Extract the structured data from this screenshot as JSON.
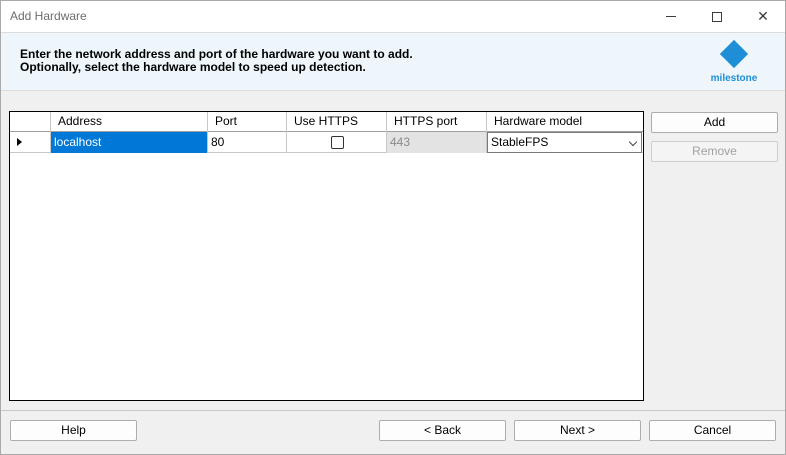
{
  "window": {
    "title": "Add Hardware",
    "controls": {
      "minimize": "",
      "maximize": "",
      "close": "✕"
    }
  },
  "header": {
    "line1": "Enter the network address and port of the hardware you want to add.",
    "line2": "Optionally, select the hardware model to speed up detection.",
    "logo_text": "milestone"
  },
  "grid": {
    "columns": [
      "Address",
      "Port",
      "Use HTTPS",
      "HTTPS port",
      "Hardware model"
    ],
    "rows": [
      {
        "address": "localhost",
        "port": "80",
        "use_https": false,
        "https_port": "443",
        "hardware_model": "StableFPS"
      }
    ]
  },
  "side_buttons": {
    "add": "Add",
    "remove": "Remove"
  },
  "footer": {
    "help": "Help",
    "back": "< Back",
    "next": "Next >",
    "cancel": "Cancel"
  },
  "colors": {
    "selection": "#0078d7",
    "brand": "#1e8fd6",
    "header_band": "#eef6fb"
  }
}
